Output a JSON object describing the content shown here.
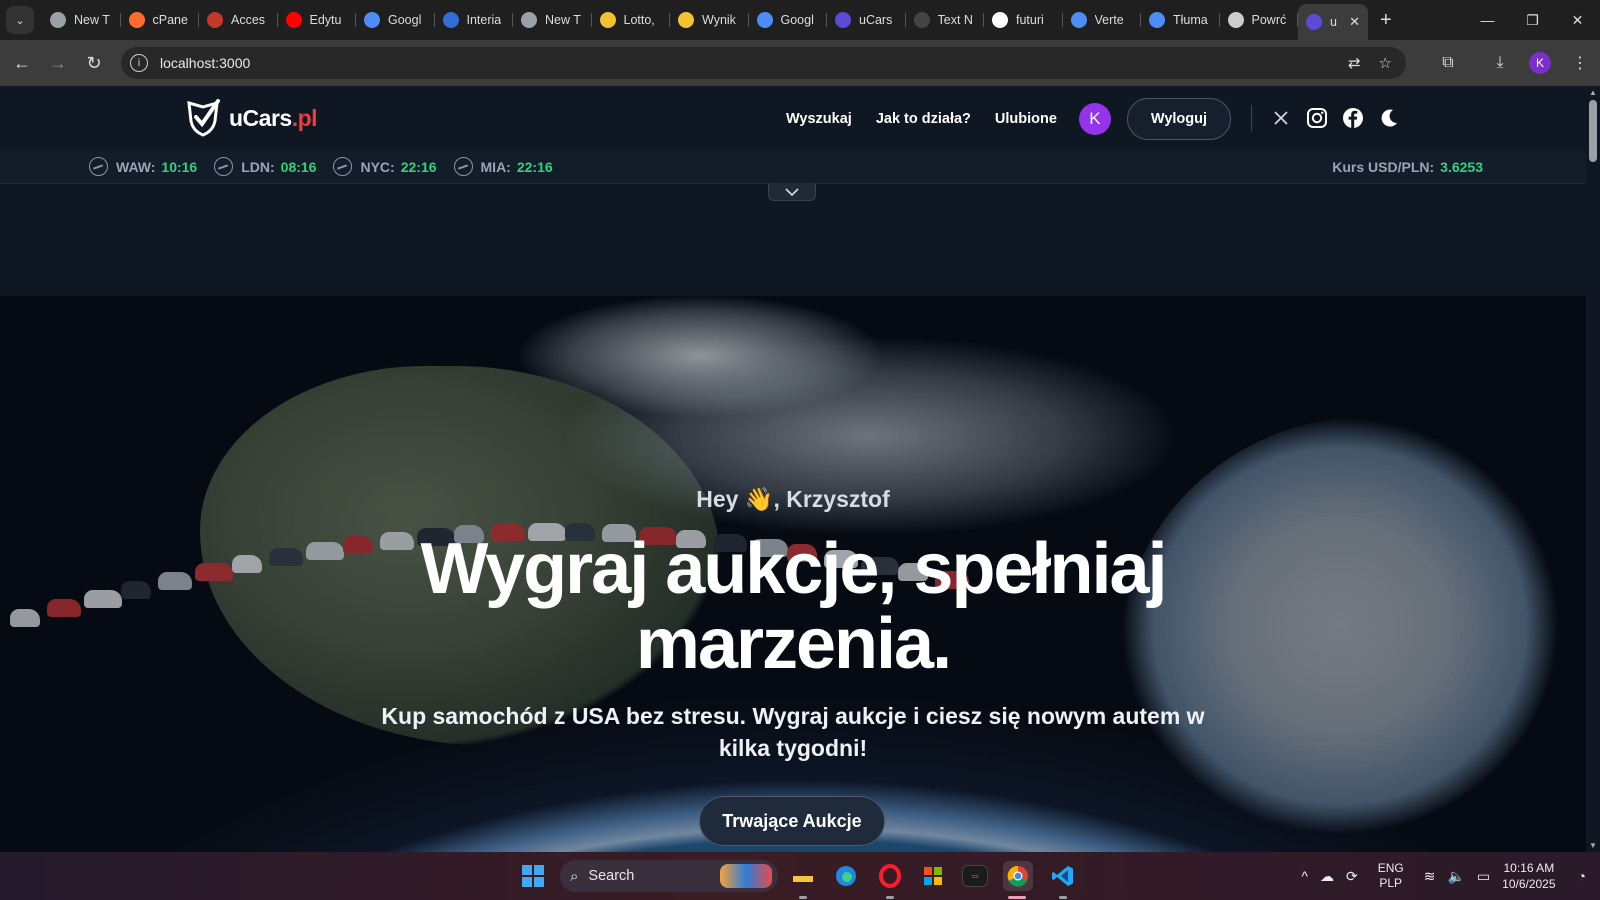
{
  "browser": {
    "tabs": [
      {
        "title": "New T",
        "icon": "chrome-icon",
        "color": "#9aa0a6"
      },
      {
        "title": "cPane",
        "icon": "cpanel-icon",
        "color": "#ff6c2c"
      },
      {
        "title": "Acces",
        "icon": "access-icon",
        "color": "#c0392b"
      },
      {
        "title": "Edytu",
        "icon": "youtube-icon",
        "color": "#ff0000"
      },
      {
        "title": "Googl",
        "icon": "gemini-icon",
        "color": "#4e8df5"
      },
      {
        "title": "Interia",
        "icon": "interia-icon",
        "color": "#2f6fd6"
      },
      {
        "title": "New T",
        "icon": "chrome-icon",
        "color": "#9aa0a6"
      },
      {
        "title": "Lotto,",
        "icon": "lotto-icon",
        "color": "#f2c230"
      },
      {
        "title": "Wynik",
        "icon": "star-icon",
        "color": "#f2c230"
      },
      {
        "title": "Googl",
        "icon": "gemini-icon",
        "color": "#4e8df5"
      },
      {
        "title": "uCars",
        "icon": "ucars-icon",
        "color": "#5b4bd6"
      },
      {
        "title": "Text N",
        "icon": "text-icon",
        "color": "#444444"
      },
      {
        "title": "futuri",
        "icon": "google-icon",
        "color": "#ffffff"
      },
      {
        "title": "Verte",
        "icon": "vertex-icon",
        "color": "#4e8df5"
      },
      {
        "title": "Tłuma",
        "icon": "translate-icon",
        "color": "#4e8df5"
      },
      {
        "title": "Powrć",
        "icon": "openai-icon",
        "color": "#cccccc"
      }
    ],
    "active_tab": {
      "title": "u",
      "icon": "ucars-icon"
    },
    "url": "localhost:3000"
  },
  "site": {
    "logo": {
      "name": "uCars",
      "tld": ".pl"
    },
    "nav": {
      "search": "Wyszukaj",
      "how": "Jak to działa?",
      "favorites": "Ulubione",
      "avatar_letter": "K",
      "logout": "Wyloguj"
    },
    "social": [
      "x-icon",
      "instagram-icon",
      "facebook-icon",
      "moon-icon"
    ],
    "clocks": [
      {
        "city": "WAW:",
        "time": "10:16"
      },
      {
        "city": "LDN:",
        "time": "08:16"
      },
      {
        "city": "NYC:",
        "time": "22:16"
      },
      {
        "city": "MIA:",
        "time": "22:16"
      }
    ],
    "rate": {
      "label": "Kurs USD/PLN:",
      "value": "3.6253"
    },
    "hero": {
      "greeting": "Hey 👋, Krzysztof",
      "headline": "Wygraj aukcje, spełniaj marzenia.",
      "subtitle": "Kup samochód z USA bez stresu. Wygraj aukcje i ciesz się nowym autem w kilka tygodni!",
      "cta": "Trwające Aukcje"
    },
    "accent_colors": {
      "green": "#33d17a",
      "red": "#ef3b3b",
      "purple": "#9333ea"
    }
  },
  "taskbar": {
    "search_label": "Search",
    "apps": [
      "file-explorer-icon",
      "edge-icon",
      "opera-icon",
      "store-icon",
      "terminal-icon",
      "chrome-icon",
      "vscode-icon"
    ],
    "lang_line1": "ENG",
    "lang_line2": "PLP",
    "time": "10:16 AM",
    "date": "10/6/2025"
  }
}
